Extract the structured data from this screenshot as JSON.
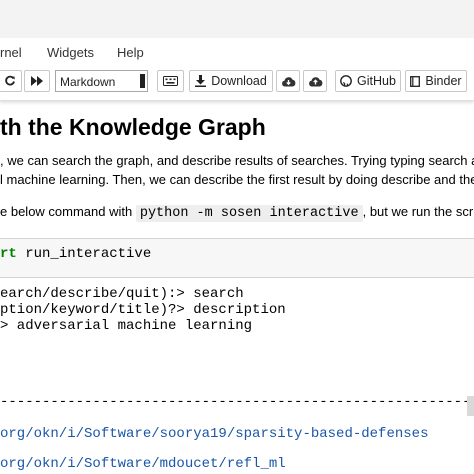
{
  "menu": {
    "items": [
      "rnel",
      "Widgets",
      "Help"
    ]
  },
  "toolbar": {
    "cell_type": "Markdown",
    "download_label": "Download",
    "github_label": "GitHub",
    "binder_label": "Binder"
  },
  "notebook": {
    "heading": "th the Knowledge Graph",
    "para1_line1": ", we can search the graph, and describe results of searches. Trying typing search an",
    "para1_line2": "l machine learning. Then, we can describe the first result by doing describe and ther",
    "para2_before": "e below command with ",
    "para2_code": "python -m sosen interactive",
    "para2_after": ", but we run the script f",
    "code_keyword": "rt",
    "code_rest": " run_interactive",
    "output": [
      "earch/describe/quit):> search",
      "ption/keyword/title)?> description",
      "> adversarial machine learning"
    ],
    "divider": "---------------------------------------------------------------------",
    "links": [
      "org/okn/i/Software/soorya19/sparsity-based-defenses",
      "org/okn/i/Software/mdoucet/refl_ml"
    ]
  },
  "colors": {
    "keyword": "#008000",
    "link": "#1a56a8",
    "code_bg": "#f7f7f7"
  }
}
